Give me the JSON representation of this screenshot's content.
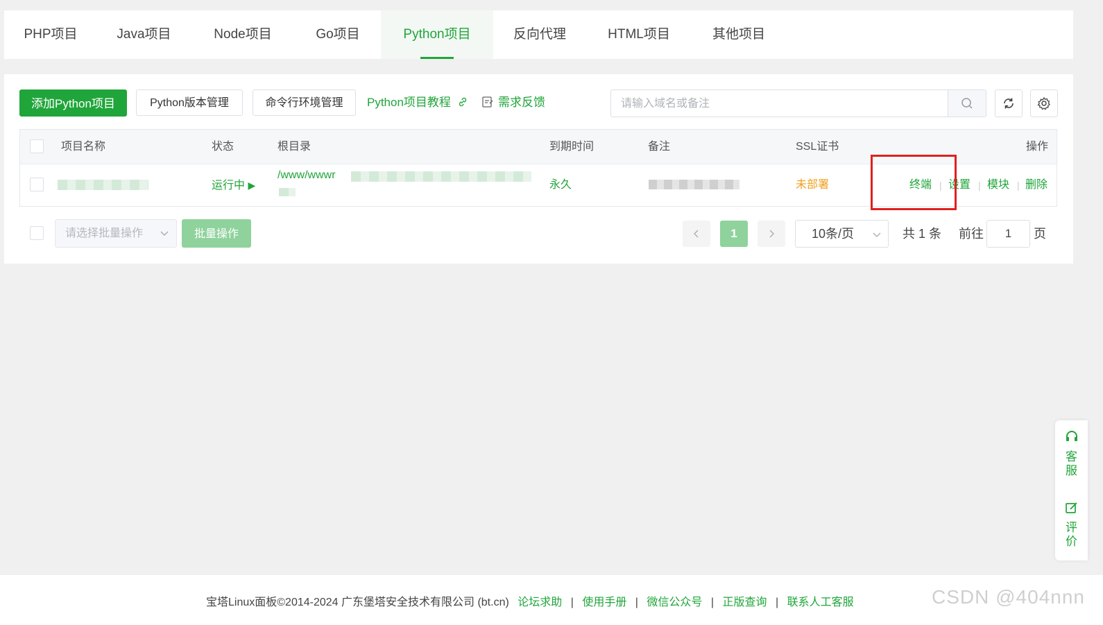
{
  "tabs": [
    {
      "label": "PHP项目"
    },
    {
      "label": "Java项目"
    },
    {
      "label": "Node项目"
    },
    {
      "label": "Go项目"
    },
    {
      "label": "Python项目"
    },
    {
      "label": "反向代理"
    },
    {
      "label": "HTML项目"
    },
    {
      "label": "其他项目"
    }
  ],
  "active_tab": "Python项目",
  "toolbar": {
    "add_label": "添加Python项目",
    "version_label": "Python版本管理",
    "cli_label": "命令行环境管理",
    "tutorial_label": "Python项目教程",
    "feedback_label": "需求反馈",
    "search_placeholder": "请输入域名或备注"
  },
  "table": {
    "headers": {
      "name": "项目名称",
      "status": "状态",
      "root": "根目录",
      "expire": "到期时间",
      "remark": "备注",
      "ssl": "SSL证书",
      "ops": "操作"
    },
    "rows": [
      {
        "status": "运行中",
        "root": "/www/wwwr",
        "expire": "永久",
        "ssl": "未部署",
        "ops": [
          "终端",
          "设置",
          "模块",
          "删除"
        ]
      }
    ]
  },
  "batch": {
    "select_placeholder": "请选择批量操作",
    "apply_label": "批量操作"
  },
  "pagination": {
    "current_page": "1",
    "page_size": "10条/页",
    "total": "共 1 条",
    "goto_label": "前往",
    "goto_value": "1",
    "page_suffix": "页"
  },
  "side": {
    "service": "客服",
    "review": "评价"
  },
  "footer": {
    "copyright": "宝塔Linux面板©2014-2024 广东堡塔安全技术有限公司 (bt.cn)",
    "links": [
      "论坛求助",
      "使用手册",
      "微信公众号",
      "正版查询",
      "联系人工客服"
    ],
    "watermark": "CSDN @404nnn"
  },
  "colors": {
    "accent": "#20a53a",
    "warning": "#f0a020",
    "highlight_box": "#e02020"
  }
}
